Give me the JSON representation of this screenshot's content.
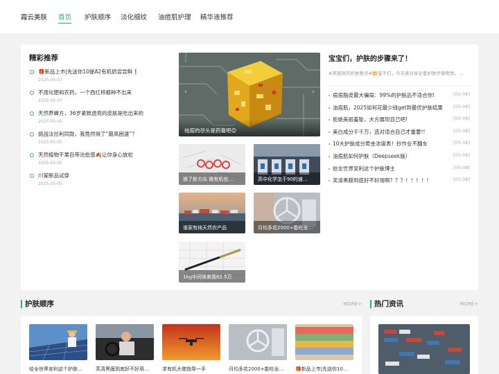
{
  "nav": {
    "logo": "霞云美肤",
    "items": [
      "首页",
      "护肤顺序",
      "淡化细纹",
      "油痘肌护理",
      "精华液推荐"
    ]
  },
  "featured": {
    "title": "精彩推荐",
    "items": [
      {
        "title": "🎁新品上市|先送你10提A2有机奶尝尝鲜❗",
        "date": "2025-05-07"
      },
      {
        "title": "不用化肥和农药，一个西红柿都种不出来",
        "date": "2025-05-07"
      },
      {
        "title": "天然养蜂方，36岁紧致透亮的皮肤是吃出来的",
        "date": "2025-05-05"
      },
      {
        "title": "挑战法拉利同款，我竟然得了“最高困速”？",
        "date": "2025-05-05"
      },
      {
        "title": "天然植物干果自带治愈感🍂让你身心放松",
        "date": "2025-05-05"
      },
      {
        "title": "川棠新品试穿",
        "date": "2025-05-05"
      }
    ]
  },
  "carousel": {
    "caption": "祛痘的尽头是药膏吧😊",
    "prev": "‹",
    "next": "›"
  },
  "thumbs": [
    "换了新方向 做有机也…",
    "高中化学怎于90的速…",
    "谁家有纯天然农产品",
    "月均多花2000+能吃全…",
    "1kg中间体卖我82.5万"
  ],
  "guide": {
    "title": "宝宝们，护肤的步骤来了！",
    "subtitle": "#美容员的护肤要点#💥宝子们，今天来分享全套护肤步骤呢😎。…",
    "items": [
      {
        "title": "痘痘脂皮最大骗局：99%的护肤品不适合你!",
        "date": "[05-08]"
      },
      {
        "title": "油痘肌，2025如何花最少钱get到最优护肤结果",
        "date": "[05-08]"
      },
      {
        "title": "拒绝美丽羞耻，大方展现自己吧!",
        "date": "[05-08]"
      },
      {
        "title": "美白成分千千万，选对适合自己才重要!!",
        "date": "[05-08]"
      },
      {
        "title": "10大护肤成分黄金浓度表！抄作业不翻车",
        "date": "[05-08]"
      },
      {
        "title": "油痘肌如何护肤（Deepseek版）",
        "date": "[05-08]"
      },
      {
        "title": "给全世界安利这个护肤博主",
        "date": "[05-08]"
      },
      {
        "title": "芙清黑膜到底好不好用啊？？？！！！！！",
        "date": "[05-08]"
      }
    ]
  },
  "sections": {
    "left_title": "护肤顺序",
    "left_more": "MORE+",
    "right_title": "热门资讯",
    "right_more": "MORE+"
  },
  "bottom_items": [
    "给全世界安利这个护肤…",
    "芙清黑膜到底好不好用…",
    "求有机大佬指导一手",
    "月均多花2000+能吃全…",
    "🎁新品上市|先送你10…"
  ],
  "colors": {
    "accent": "#27b27d",
    "background": "#f2f2f2"
  }
}
